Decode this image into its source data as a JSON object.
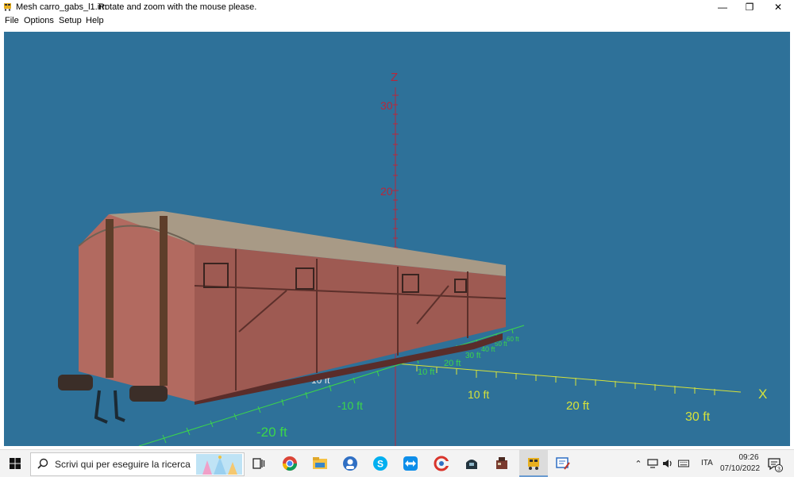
{
  "window": {
    "title": "Mesh carro_gabs_l1.im",
    "hint": "Rotate and zoom with the mouse please.",
    "buttons": [
      "minimize-icon",
      "restore-icon",
      "close-icon"
    ]
  },
  "menu": [
    "File",
    "Options",
    "Setup",
    "Help"
  ],
  "viewport": {
    "background": "#2e7199",
    "z_axis": {
      "label": "Z",
      "ticks": [
        "30",
        "20"
      ],
      "color": "#b8273a"
    },
    "x_axis": {
      "label": "X",
      "ticks": [
        "10 ft",
        "20 ft",
        "30 ft"
      ],
      "color": "#d6e23a"
    },
    "y_axis": {
      "color": "#3cd64a",
      "neg_ticks": [
        "-10 ft",
        "-20 ft"
      ],
      "pos_ticks": [
        "10 ft",
        "20 ft",
        "30 ft",
        "40 ft",
        "50 ft",
        "60 ft"
      ],
      "near_origin": "-10 ft"
    },
    "model": {
      "name": "freight boxcar",
      "body_color": "#9e5a52",
      "roof_color": "#a89a86"
    }
  },
  "taskbar": {
    "search_placeholder": "Scrivi qui per eseguire la ricerca",
    "apps": [
      "task-view-icon",
      "chrome-icon",
      "file-explorer-icon",
      "blue-app-icon",
      "skype-icon",
      "teamviewer-icon",
      "ccleaner-icon",
      "trainz-icon",
      "cab-app-icon",
      "mesh-viewer-icon",
      "editor-icon"
    ],
    "tray": {
      "lang": "ITA",
      "time": "09:26",
      "date": "07/10/2022",
      "notifications": "3"
    }
  }
}
